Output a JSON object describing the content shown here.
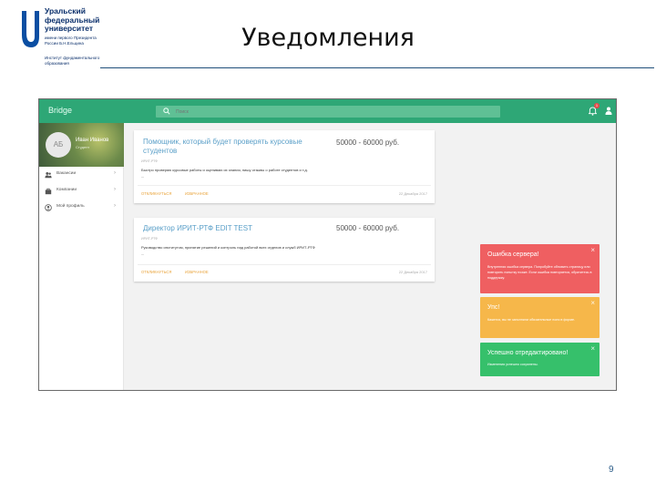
{
  "logo": {
    "lines": [
      "Уральский",
      "федеральный",
      "университет"
    ],
    "subtitle": "имени первого Президента России Б.Н.Ельцина",
    "subtitle2": "Институт фундаментального образования"
  },
  "slide": {
    "title": "Уведомления",
    "page_number": "9"
  },
  "app": {
    "brand": "Bridge",
    "search_placeholder": "Поиск",
    "notification_count": "1",
    "colors": {
      "header": "#2ea776",
      "error": "#ef5f61",
      "warning": "#f6b74a",
      "success": "#36c06b",
      "link": "#5a9fc8",
      "action": "#e9a33a"
    },
    "profile": {
      "initials": "АБ",
      "name": "Иван Иванов",
      "role": "Студент"
    },
    "nav": [
      {
        "icon": "people-icon",
        "label": "Вакансии"
      },
      {
        "icon": "briefcase-icon",
        "label": "Компании"
      },
      {
        "icon": "account-icon",
        "label": "Мой профиль"
      }
    ],
    "cards": [
      {
        "title": "Помощник, который будет проверять курсовые студентов",
        "salary": "50000 - 60000 руб.",
        "meta": "ИРИТ-РТФ",
        "description": "Быстро проверяю курсовые работы и оцениваю их знания, пишу отзывы о работе студентов и т.д.",
        "more": "...",
        "actions": [
          "ОТКЛИКНУТЬСЯ",
          "ИЗБРАННОЕ"
        ],
        "date": "22 Декабря 2017"
      },
      {
        "title": "Директор ИРИТ-РТФ EDIT TEST",
        "salary": "50000 - 60000 руб.",
        "meta": "ИРИТ-РТФ",
        "description": "Руководство институтом, принятие решений и контроль над работой всех отделов и служб ИРИТ-РТФ",
        "more": "...",
        "actions": [
          "ОТКЛИКНУТЬСЯ",
          "ИЗБРАННОЕ"
        ],
        "date": "22 Декабря 2017"
      }
    ],
    "toasts": [
      {
        "kind": "error",
        "title": "Ошибка сервера!",
        "close": "×",
        "body": "Внутренняя ошибка сервера. Попробуйте обновить страницу или повторить попытку позже. Если ошибка повторяется, обратитесь в поддержку."
      },
      {
        "kind": "warning",
        "title": "Упс!",
        "close": "×",
        "body": "Кажется, вы не заполнили обязательные поля в форме."
      },
      {
        "kind": "success",
        "title": "Успешно отредактировано!",
        "close": "×",
        "body": "Изменения успешно сохранены."
      }
    ]
  }
}
